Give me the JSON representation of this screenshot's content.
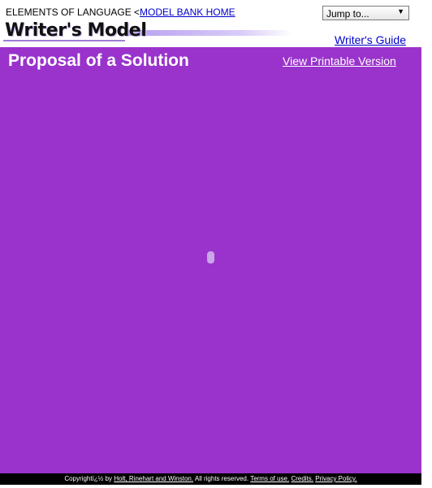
{
  "header": {
    "breadcrumb_prefix": "ELEMENTS OF LANGUAGE <",
    "breadcrumb_link": "MODEL BANK HOME",
    "jump_select": {
      "selected": "Jump to...",
      "arrow": "▼"
    },
    "logo_text": "Writer's Model",
    "guide_link": "Writer's Guide"
  },
  "main": {
    "title": "Proposal of a Solution",
    "printable_link": "View Printable Version"
  },
  "footer": {
    "prefix": "Copyrightï¿½ by ",
    "publisher_link": "Holt, Rinehart and Winston.",
    "rights": " All rights reserved. ",
    "terms_link": "Terms of use.",
    "credits_link": "Credits.",
    "privacy_link": "Privacy Policy."
  },
  "colors": {
    "main_background": "#9933cc",
    "link": "#0000cc",
    "footer_background": "#000000"
  }
}
